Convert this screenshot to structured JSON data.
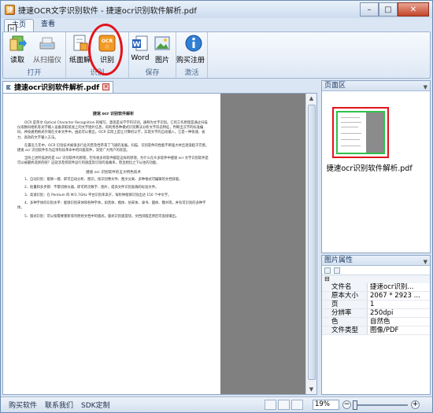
{
  "window": {
    "title": "捷速OCR文字识别软件 - 捷速ocr识别软件解析.pdf"
  },
  "ribbon_tabs": [
    {
      "label": "主页",
      "key": "H"
    },
    {
      "label": "查看"
    }
  ],
  "groups": {
    "open": "打开",
    "recognize": "识别",
    "save": "保存",
    "activate": "激活"
  },
  "buttons": {
    "read": "读取",
    "scan": "从扫描仪",
    "page_parse": "纸面解",
    "recognize": "识别",
    "word": "Word",
    "image": "图片",
    "buy": "购买注册"
  },
  "document_tab": {
    "name": "捷速ocr识别软件解析.pdf"
  },
  "page_panel": {
    "title": "页面区",
    "thumb_name": "捷速ocr识别软件解析.pdf"
  },
  "properties_panel": {
    "title": "图片属性",
    "rows": [
      {
        "key": "文件名",
        "value": "捷速ocr识别..."
      },
      {
        "key": "原本大小",
        "value": "2067 * 2923 ..."
      },
      {
        "key": "页",
        "value": "1"
      },
      {
        "key": "分辨率",
        "value": "250dpi"
      },
      {
        "key": "色",
        "value": "自然色"
      },
      {
        "key": "文件类型",
        "value": "图像/PDF"
      }
    ]
  },
  "doc_page": {
    "title": "捷速 ocr 识别软件解析",
    "paragraphs": [
      "OCR 是英文 Optical Character Recognition 的缩写，意思是光学字符识别，通称为文字识别。它的工作原理是通过扫描仪或数码相机等光学输入设备获取纸张上的文字图片信息，再利用各种模式识别算法分析文字形态特征，判断出汉字的标准编码，并按通用格式存储在文本文件中。由此可以看出，OCR 实际上是让计算机认字，实现文字的自动输入，它是一种快速、省力、高效的文字输入方法。",
      "在最近几年中，OCR 识别技术被很多行业的普及性带来了飞速的发展。扫描、识别软件的性能不断强大并且逐渐趋于完善。捷速 ocr 识别软件作为这项科技革命中的同类软件，深受广大用户的欢迎。",
      "当你上述所描述的是 ocr 识别软件的原理，但有很多的软件都是这样的原理，为什么在众多软件中捷速 ocr 文字识别软件是可以被最终选择的呢？这就涉及到软件运行的速度及识别的准确率，而且相比之下以往的功能。"
    ],
    "mid": "捷速 ocr 识别软件的五大特色技术",
    "list": [
      "1、自动识别：能够一键、即可自动分析、图识，按识别像文件、图文分离、多种格式可编辑的文档排版。",
      "2、批量和多步骤：不需切换仪器，即可跨页数字、图片，提高文件识别准确的标准文件。",
      "3、高速识别：在 Pentium 四 M/1.7GHz 平台识别率高于，每秒钟能够识别出达 150 个中文字。",
      "4、多种字体的识别水平：能够识别宋体和各种字体，如黑体、楷体、仿宋体、隶书、圆体、魏书等，并有可识别的多种字体。",
      "5、版式识别：可以按需要重新排列原始文档中的版式，版式识别速度快，文档排版还原后可直接输出。"
    ]
  },
  "status": {
    "links": [
      "购买软件",
      "联系我们",
      "SDK定制"
    ],
    "zoom": "19%"
  },
  "colors": {
    "highlight": "#e2141b",
    "thumb_border": "#31c14a",
    "ribbon_bg": "#dde8f5"
  }
}
